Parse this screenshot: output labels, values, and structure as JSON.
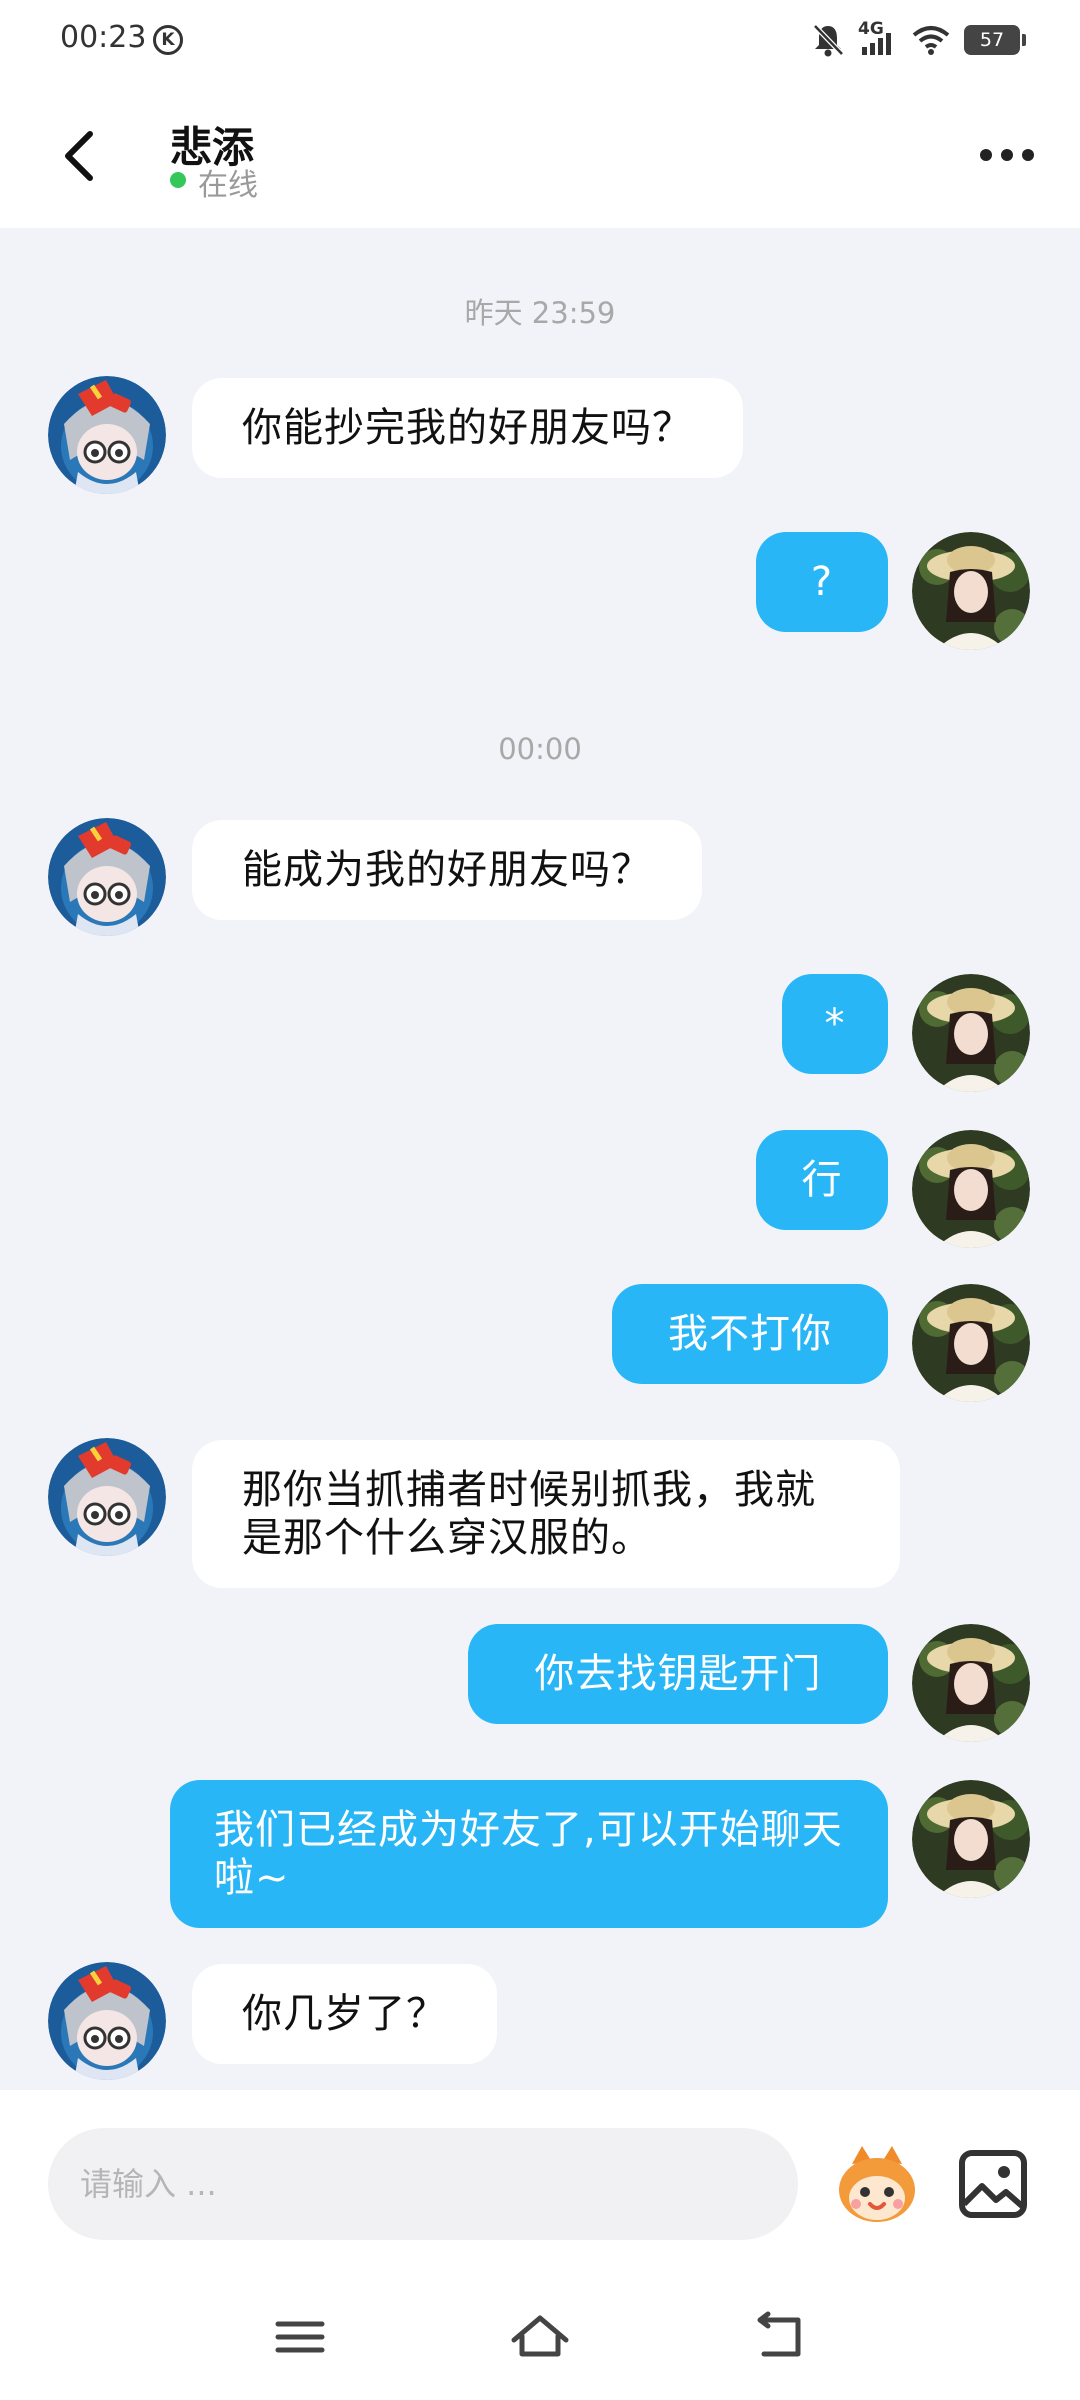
{
  "status_bar": {
    "time": "00:23",
    "k_badge": "K",
    "network": "4G",
    "battery": "57",
    "icons": [
      "bell-off-icon",
      "signal-icon",
      "wifi-icon",
      "battery-icon"
    ]
  },
  "header": {
    "name": "悲添",
    "status": "在线",
    "status_color": "#34c759"
  },
  "chat": {
    "timestamps": [
      "昨天 23:59",
      "00:00"
    ],
    "messages": [
      {
        "side": "in",
        "text": "你能抄完我的好朋友吗？"
      },
      {
        "side": "out",
        "text": "?"
      },
      {
        "side": "in",
        "text": "能成为我的好朋友吗？"
      },
      {
        "side": "out",
        "text": "*"
      },
      {
        "side": "out",
        "text": "行"
      },
      {
        "side": "out",
        "text": "我不打你"
      },
      {
        "side": "in",
        "text": "那你当抓捕者时候别抓我，我就是那个什么穿汉服的。"
      },
      {
        "side": "out",
        "text": "你去找钥匙开门"
      },
      {
        "side": "out",
        "text": "我们已经成为好友了,可以开始聊天啦~"
      },
      {
        "side": "in",
        "text": "你几岁了？"
      }
    ]
  },
  "input": {
    "placeholder": "请输入 ..."
  },
  "colors": {
    "accent": "#29b6f6",
    "background": "#f1f3f9",
    "incoming_bubble": "#ffffff"
  }
}
